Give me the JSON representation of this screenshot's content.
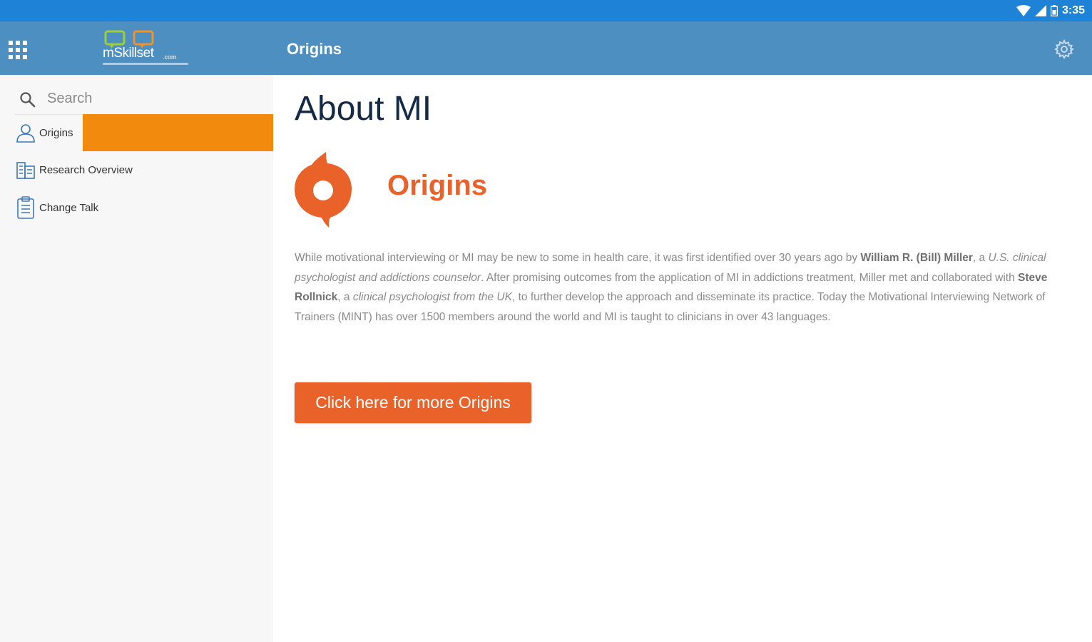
{
  "status_bar": {
    "time": "3:35"
  },
  "app_bar": {
    "logo": {
      "text": "mSkillset",
      "domain": ".com"
    },
    "title": "Origins"
  },
  "sidebar": {
    "search": {
      "placeholder": "Search"
    },
    "items": [
      {
        "label": "Origins",
        "icon": "person-icon",
        "selected": true
      },
      {
        "label": "Research Overview",
        "icon": "research-icon",
        "selected": false
      },
      {
        "label": "Change Talk",
        "icon": "clipboard-icon",
        "selected": false
      }
    ]
  },
  "main": {
    "heading": "About MI",
    "section_title": "Origins",
    "paragraph": {
      "t1": "While motivational interviewing or MI may be new to some in health care, it was first identified over 30 years ago by ",
      "b1": "William R. (Bill) Miller",
      "t2": ", a ",
      "i1": "U.S. clinical psychologist and addictions counselor",
      "t3": ". After promising outcomes from the application of MI in addictions treatment, Miller met and collaborated with ",
      "b2": "Steve Rollnick",
      "t4": ", a ",
      "i2": "clinical psychologist from the UK",
      "t5": ", to further develop the approach and disseminate its practice. Today the Motivational Interviewing Network of Trainers (MINT) has over 1500 members around the world and MI is taught to clinicians in over 43 languages."
    },
    "cta_label": "Click here for more Origins"
  },
  "colors": {
    "status_bar": "#1e83d6",
    "app_bar": "#4e8fc1",
    "accent_orange": "#e8622a",
    "highlight_orange": "#f28a0e",
    "heading": "#152a44"
  }
}
